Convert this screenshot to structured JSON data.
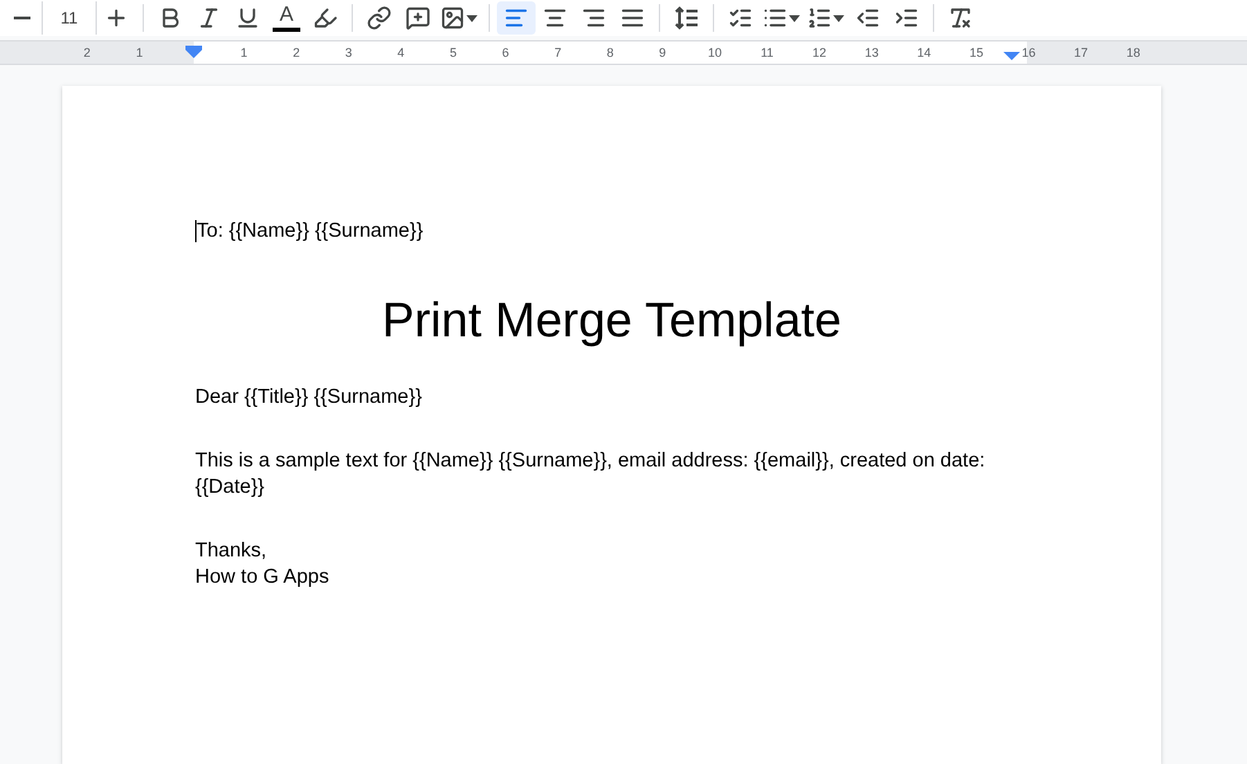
{
  "toolbar": {
    "font_size": "11",
    "text_color": {
      "label": "A",
      "color": "#000000"
    },
    "alignment": [
      {
        "kind": "left",
        "selected": true
      },
      {
        "kind": "center",
        "selected": false
      },
      {
        "kind": "right",
        "selected": false
      },
      {
        "kind": "justify",
        "selected": false
      }
    ]
  },
  "ruler": {
    "left_labels": [
      "2",
      "1"
    ],
    "right_labels": [
      "1",
      "2",
      "3",
      "4",
      "5",
      "6",
      "7",
      "8",
      "9",
      "10",
      "11",
      "12",
      "13",
      "14",
      "15",
      "16",
      "17",
      "18"
    ]
  },
  "document": {
    "recipient": "To: {{Name}} {{Surname}}",
    "title": "Print Merge Template",
    "paragraphs": [
      [
        "Dear {{Title}} {{Surname}}"
      ],
      [
        "This is a sample text for {{Name}} {{Surname}}, email address: {{email}}, created on date: {{Date}}"
      ],
      [
        "Thanks,",
        "How to G Apps"
      ]
    ]
  }
}
